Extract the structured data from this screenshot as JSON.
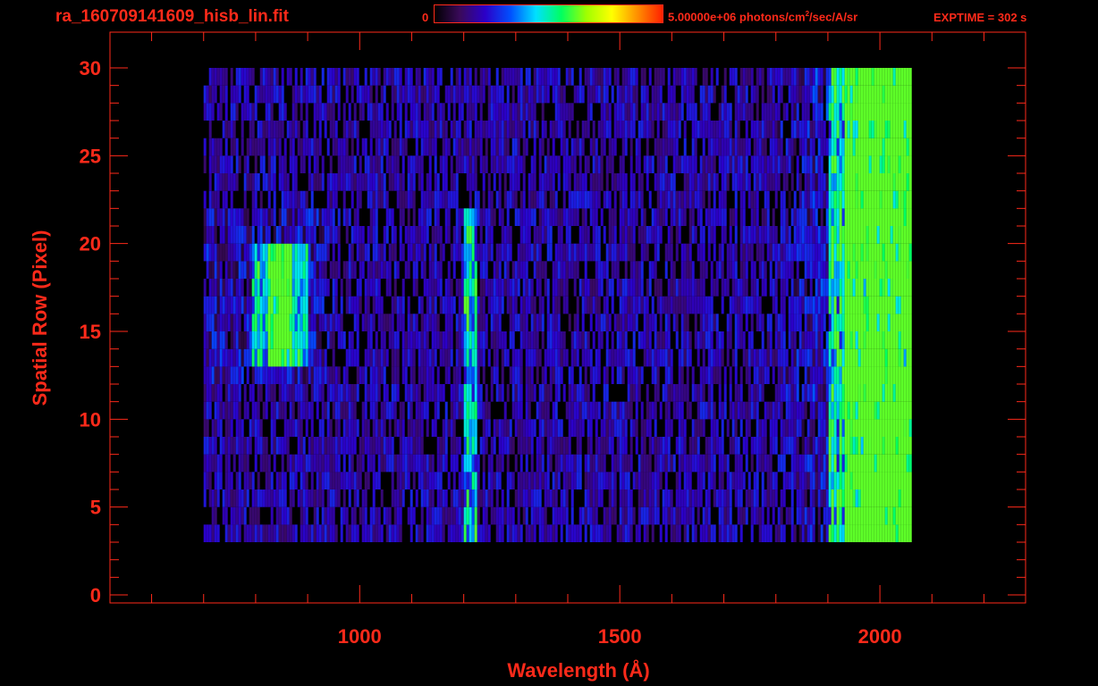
{
  "header": {
    "filename": "ra_160709141609_hisb_lin.fit",
    "colorbar_min": "0",
    "colorbar_max_prefix": "5.00000e+06 photons/cm",
    "colorbar_max_sup": "2",
    "colorbar_max_suffix": "/sec/A/sr",
    "exptime": "EXPTIME = 302 s"
  },
  "colors": {
    "axis": "#ff2a1a",
    "background": "#000000",
    "colormap": [
      "#000000",
      "#3a0a5a",
      "#2b00c8",
      "#0050ff",
      "#00e0ff",
      "#00ff60",
      "#a0ff00",
      "#ffff00",
      "#ff9000",
      "#ff2000"
    ]
  },
  "chart_data": {
    "type": "heatmap",
    "title": "ra_160709141609_hisb_lin.fit",
    "xlabel": "Wavelength (Å)",
    "ylabel": "Spatial Row (Pixel)",
    "xlim": [
      520,
      2280
    ],
    "ylim": [
      0,
      30
    ],
    "x_ticks": [
      1000,
      1500,
      2000
    ],
    "y_ticks": [
      0,
      5,
      10,
      15,
      20,
      25,
      30
    ],
    "colorbar_range": [
      0,
      5000000
    ],
    "colorbar_unit": "photons/cm^2/sec/A/sr",
    "data_extent_x": [
      700,
      2060
    ],
    "data_extent_y": [
      3,
      30
    ],
    "features": [
      {
        "x_range": [
          820,
          870
        ],
        "y_range": [
          13,
          20
        ]
      },
      {
        "x_range": [
          1200,
          1225
        ],
        "y_range": [
          3,
          22
        ]
      },
      {
        "x_range": [
          1900,
          2060
        ],
        "y_range": [
          3,
          30
        ]
      }
    ]
  }
}
